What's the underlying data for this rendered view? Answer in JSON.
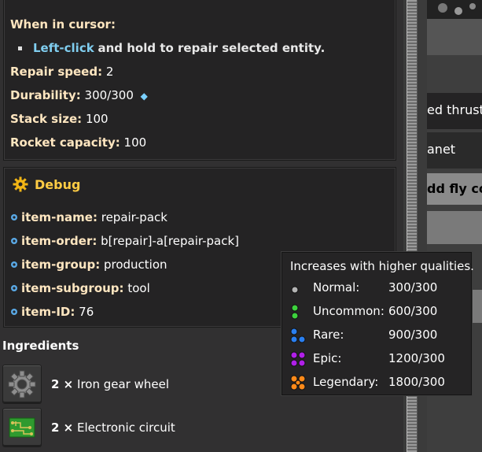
{
  "top_fragment": "˒ ˓",
  "cursor_section": {
    "title": "When in cursor:",
    "action_link": "Left-click",
    "action_rest": "and hold to repair selected entity."
  },
  "stats": [
    {
      "label": "Repair speed:",
      "value": "2"
    },
    {
      "label": "Durability:",
      "value": "300/300"
    },
    {
      "label": "Stack size:",
      "value": "100"
    },
    {
      "label": "Rocket capacity:",
      "value": "100"
    }
  ],
  "debug": {
    "title": "Debug",
    "rows": [
      {
        "label": "item-name:",
        "value": "repair-pack"
      },
      {
        "label": "item-order:",
        "value": "b[repair]-a[repair-pack]"
      },
      {
        "label": "item-group:",
        "value": "production"
      },
      {
        "label": "item-subgroup:",
        "value": "tool"
      },
      {
        "label": "item-ID:",
        "value": "76"
      }
    ]
  },
  "ingredients": {
    "title": "Ingredients",
    "items": [
      {
        "count": "2 ×",
        "name": "Iron gear wheel",
        "icon": "iron-gear-wheel-icon"
      },
      {
        "count": "2 ×",
        "name": "Electronic circuit",
        "icon": "electronic-circuit-icon"
      }
    ]
  },
  "right_panel": {
    "text1": "ed thrust",
    "text2": "anet",
    "text3": "dd fly co"
  },
  "quality_tooltip": {
    "title": "Increases with higher qualities.",
    "rows": [
      {
        "name": "Normal:",
        "value": "300/300",
        "color": "#b4b4b4"
      },
      {
        "name": "Uncommon:",
        "value": "600/300",
        "color": "#3dd23d"
      },
      {
        "name": "Rare:",
        "value": "900/300",
        "color": "#2a7ff0"
      },
      {
        "name": "Epic:",
        "value": "1200/300",
        "color": "#b020e8"
      },
      {
        "name": "Legendary:",
        "value": "1800/300",
        "color": "#ff8a1a"
      }
    ]
  },
  "colors": {
    "label": "#ffe6c0",
    "link": "#80cef0",
    "debug_title": "#ffcc44"
  }
}
